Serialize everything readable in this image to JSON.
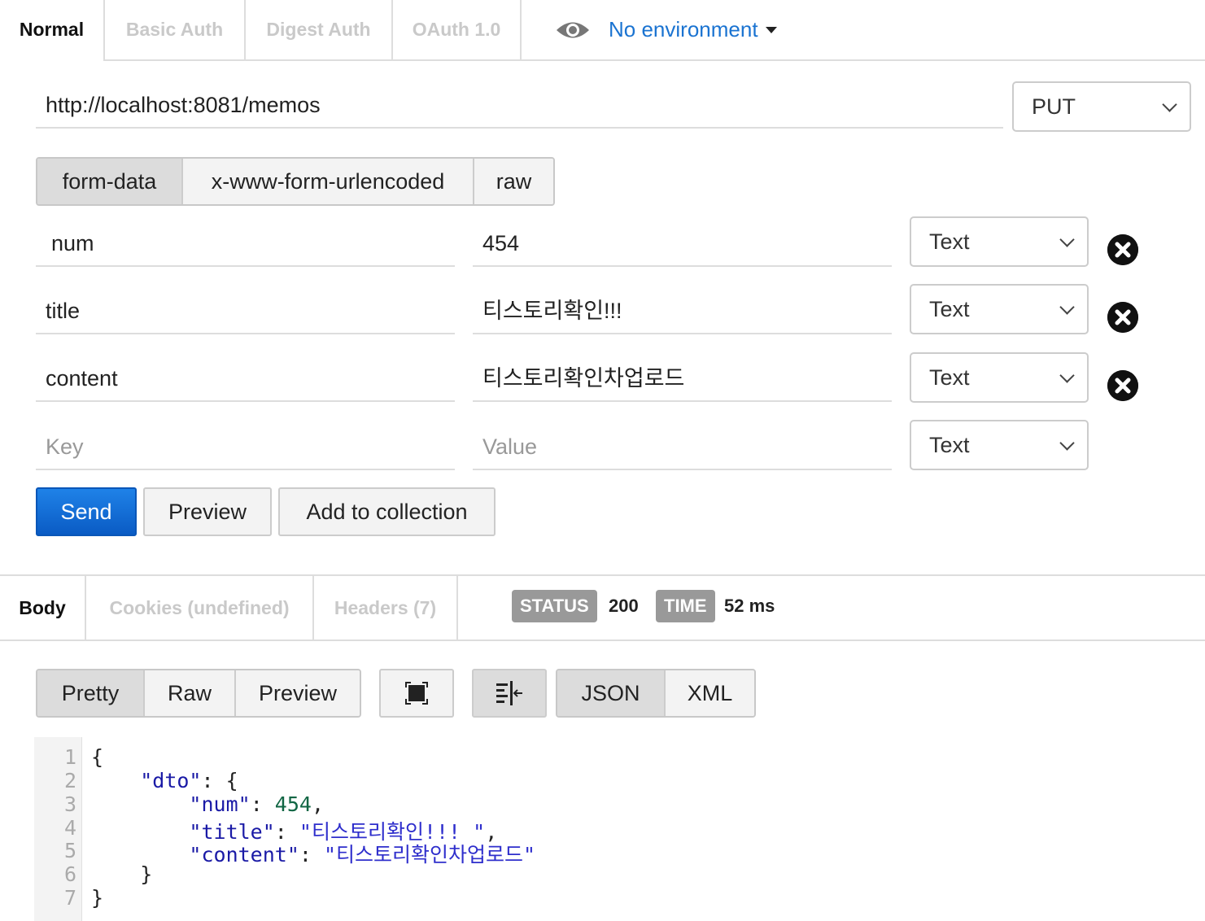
{
  "auth_tabs": [
    "Normal",
    "Basic Auth",
    "Digest Auth",
    "OAuth 1.0"
  ],
  "environment": {
    "label": "No environment"
  },
  "request": {
    "url": "http://localhost:8081/memos",
    "method": "PUT"
  },
  "body_modes": [
    "form-data",
    "x-www-form-urlencoded",
    "raw"
  ],
  "params": [
    {
      "key": "num",
      "value": "454",
      "type": "Text"
    },
    {
      "key": "title",
      "value": "티스토리확인!!!",
      "type": "Text"
    },
    {
      "key": "content",
      "value": "티스토리확인차업로드",
      "type": "Text"
    }
  ],
  "new_param": {
    "key_placeholder": "Key",
    "value_placeholder": "Value",
    "type": "Text"
  },
  "actions": {
    "send": "Send",
    "preview": "Preview",
    "add_to_collection": "Add to collection"
  },
  "response_tabs": [
    "Body",
    "Cookies (undefined)",
    "Headers (7)"
  ],
  "status": {
    "status_label": "STATUS",
    "status_value": "200",
    "time_label": "TIME",
    "time_value": "52 ms"
  },
  "view_modes": [
    "Pretty",
    "Raw",
    "Preview"
  ],
  "formats": [
    "JSON",
    "XML"
  ],
  "icons": {
    "environment": "eye-icon",
    "remove": "close-circle-icon",
    "fullscreen": "fullscreen-icon",
    "wrap": "wrap-lines-icon"
  },
  "code": {
    "line_numbers": [
      "1",
      "2",
      "3",
      "4",
      "5",
      "6",
      "7"
    ],
    "open_brace": "{",
    "dto_key": "\"dto\"",
    "num_key": "\"num\"",
    "num_value": "454",
    "title_key": "\"title\"",
    "title_value": "\"티스토리확인!!! \"",
    "content_key": "\"content\"",
    "content_value": "\"티스토리확인차업로드\"",
    "inner_close": "}",
    "close_brace": "}"
  }
}
